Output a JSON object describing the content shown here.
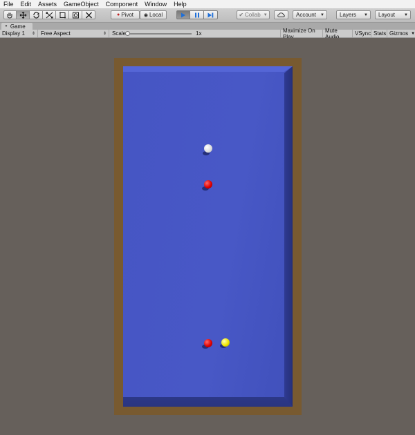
{
  "menu": [
    "File",
    "Edit",
    "Assets",
    "GameObject",
    "Component",
    "Window",
    "Help"
  ],
  "toolbar": {
    "tools": [
      "hand-tool",
      "move-tool",
      "rotate-tool",
      "scale-tool",
      "rect-tool",
      "transform-tool",
      "custom-tool"
    ],
    "pivot_label": "Pivot",
    "local_label": "Local",
    "collab_label": "Collab",
    "account_label": "Account",
    "layers_label": "Layers",
    "layout_label": "Layout"
  },
  "game_tab": {
    "title": "Game",
    "display": "Display 1",
    "aspect": "Free Aspect",
    "scale_label": "Scale",
    "scale_value": "1x",
    "maximize": "Maximize On Play",
    "mute": "Mute Audio",
    "vsync": "VSync",
    "stats": "Stats",
    "gizmos": "Gizmos"
  },
  "scene": {
    "balls": [
      "white",
      "red",
      "red",
      "yellow"
    ],
    "colors": {
      "felt": "#4655c4",
      "frame": "#785a30",
      "background": "#66605b"
    }
  }
}
